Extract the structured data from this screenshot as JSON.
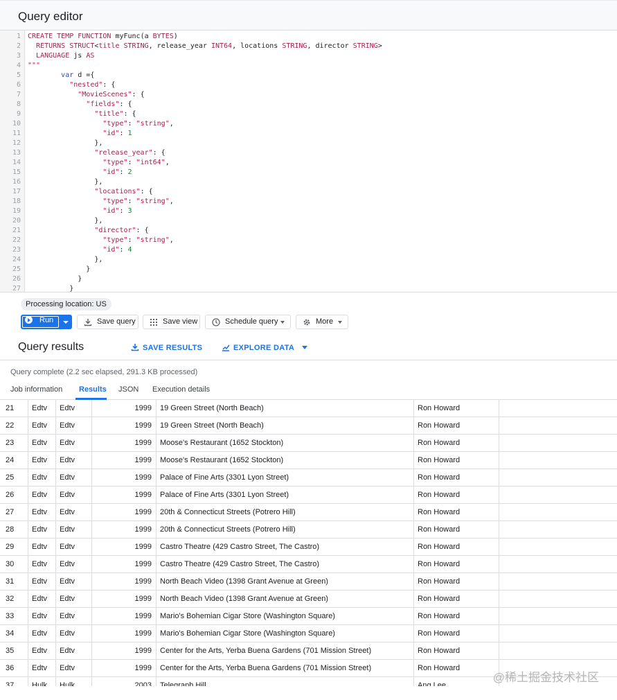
{
  "editor": {
    "title": "Query editor",
    "lines": [
      {
        "n": "1",
        "html": "<span class=\"kw\">CREATE TEMP FUNCTION</span> myFunc(a <span class=\"kw\">BYTES</span>)"
      },
      {
        "n": "2",
        "html": "  <span class=\"kw\">RETURNS STRUCT</span>&lt;<span class=\"kw\">title</span> <span class=\"kw\">STRING</span>, release_year <span class=\"kw\">INT64</span>, locations <span class=\"kw\">STRING</span>, director <span class=\"kw\">STRING</span>&gt;"
      },
      {
        "n": "3",
        "html": "  <span class=\"kw\">LANGUAGE</span> js <span class=\"kw\">AS</span>"
      },
      {
        "n": "4",
        "html": "<span class=\"str\">\"\"\"</span>"
      },
      {
        "n": "5",
        "html": "        <span class=\"id\">var</span> d ={"
      },
      {
        "n": "6",
        "html": "          <span class=\"key\">\"nested\"</span>: {"
      },
      {
        "n": "7",
        "html": "            <span class=\"key\">\"MovieScenes\"</span>: {"
      },
      {
        "n": "8",
        "html": "              <span class=\"key\">\"fields\"</span>: {"
      },
      {
        "n": "9",
        "html": "                <span class=\"key\">\"title\"</span>: {"
      },
      {
        "n": "10",
        "html": "                  <span class=\"key\">\"type\"</span>: <span class=\"str\">\"string\"</span>,"
      },
      {
        "n": "11",
        "html": "                  <span class=\"key\">\"id\"</span>: <span class=\"num\">1</span>"
      },
      {
        "n": "12",
        "html": "                },"
      },
      {
        "n": "13",
        "html": "                <span class=\"key\">\"release_year\"</span>: {"
      },
      {
        "n": "14",
        "html": "                  <span class=\"key\">\"type\"</span>: <span class=\"str\">\"int64\"</span>,"
      },
      {
        "n": "15",
        "html": "                  <span class=\"key\">\"id\"</span>: <span class=\"num\">2</span>"
      },
      {
        "n": "16",
        "html": "                },"
      },
      {
        "n": "17",
        "html": "                <span class=\"key\">\"locations\"</span>: {"
      },
      {
        "n": "18",
        "html": "                  <span class=\"key\">\"type\"</span>: <span class=\"str\">\"string\"</span>,"
      },
      {
        "n": "19",
        "html": "                  <span class=\"key\">\"id\"</span>: <span class=\"num\">3</span>"
      },
      {
        "n": "20",
        "html": "                },"
      },
      {
        "n": "21",
        "html": "                <span class=\"key\">\"director\"</span>: {"
      },
      {
        "n": "22",
        "html": "                  <span class=\"key\">\"type\"</span>: <span class=\"str\">\"string\"</span>,"
      },
      {
        "n": "23",
        "html": "                  <span class=\"key\">\"id\"</span>: <span class=\"num\">4</span>"
      },
      {
        "n": "24",
        "html": "                },"
      },
      {
        "n": "25",
        "html": "              }"
      },
      {
        "n": "26",
        "html": "            }"
      },
      {
        "n": "27",
        "html": "          }"
      }
    ]
  },
  "processing_location": "Processing location: US",
  "toolbar": {
    "run_label": "Run",
    "save_query_label": "Save query",
    "save_view_label": "Save view",
    "schedule_query_label": "Schedule query",
    "more_label": "More"
  },
  "results": {
    "title": "Query results",
    "save_results_label": "SAVE RESULTS",
    "explore_data_label": "EXPLORE DATA",
    "status": "Query complete (2.2 sec elapsed, 291.3 KB processed)",
    "tabs": [
      "Job information",
      "Results",
      "JSON",
      "Execution details"
    ],
    "active_tab": "Results",
    "rows": [
      {
        "n": "21",
        "a": "Edtv",
        "b": "Edtv",
        "year": "1999",
        "loc": "19 Green Street (North Beach)",
        "dir": "Ron Howard"
      },
      {
        "n": "22",
        "a": "Edtv",
        "b": "Edtv",
        "year": "1999",
        "loc": "19 Green Street (North Beach)",
        "dir": "Ron Howard"
      },
      {
        "n": "23",
        "a": "Edtv",
        "b": "Edtv",
        "year": "1999",
        "loc": "Moose's Restaurant (1652 Stockton)",
        "dir": "Ron Howard"
      },
      {
        "n": "24",
        "a": "Edtv",
        "b": "Edtv",
        "year": "1999",
        "loc": "Moose's Restaurant (1652 Stockton)",
        "dir": "Ron Howard"
      },
      {
        "n": "25",
        "a": "Edtv",
        "b": "Edtv",
        "year": "1999",
        "loc": "Palace of Fine Arts (3301 Lyon Street)",
        "dir": "Ron Howard"
      },
      {
        "n": "26",
        "a": "Edtv",
        "b": "Edtv",
        "year": "1999",
        "loc": "Palace of Fine Arts (3301 Lyon Street)",
        "dir": "Ron Howard"
      },
      {
        "n": "27",
        "a": "Edtv",
        "b": "Edtv",
        "year": "1999",
        "loc": "20th & Connecticut Streets (Potrero Hill)",
        "dir": "Ron Howard"
      },
      {
        "n": "28",
        "a": "Edtv",
        "b": "Edtv",
        "year": "1999",
        "loc": "20th & Connecticut Streets (Potrero Hill)",
        "dir": "Ron Howard"
      },
      {
        "n": "29",
        "a": "Edtv",
        "b": "Edtv",
        "year": "1999",
        "loc": "Castro Theatre (429 Castro Street, The Castro)",
        "dir": "Ron Howard"
      },
      {
        "n": "30",
        "a": "Edtv",
        "b": "Edtv",
        "year": "1999",
        "loc": "Castro Theatre (429 Castro Street, The Castro)",
        "dir": "Ron Howard"
      },
      {
        "n": "31",
        "a": "Edtv",
        "b": "Edtv",
        "year": "1999",
        "loc": "North Beach Video (1398 Grant Avenue at Green)",
        "dir": "Ron Howard"
      },
      {
        "n": "32",
        "a": "Edtv",
        "b": "Edtv",
        "year": "1999",
        "loc": "North Beach Video (1398 Grant Avenue at Green)",
        "dir": "Ron Howard"
      },
      {
        "n": "33",
        "a": "Edtv",
        "b": "Edtv",
        "year": "1999",
        "loc": "Mario's Bohemian Cigar Store (Washington Square)",
        "dir": "Ron Howard"
      },
      {
        "n": "34",
        "a": "Edtv",
        "b": "Edtv",
        "year": "1999",
        "loc": "Mario's Bohemian Cigar Store (Washington Square)",
        "dir": "Ron Howard"
      },
      {
        "n": "35",
        "a": "Edtv",
        "b": "Edtv",
        "year": "1999",
        "loc": "Center for the Arts, Yerba Buena Gardens (701 Mission Street)",
        "dir": "Ron Howard"
      },
      {
        "n": "36",
        "a": "Edtv",
        "b": "Edtv",
        "year": "1999",
        "loc": "Center for the Arts, Yerba Buena Gardens (701 Mission Street)",
        "dir": "Ron Howard"
      },
      {
        "n": "37",
        "a": "Hulk",
        "b": "Hulk",
        "year": "2003",
        "loc": "Telegraph Hill",
        "dir": "Ang Lee"
      }
    ]
  },
  "watermark": "@稀土掘金技术社区",
  "colors": {
    "accent": "#1a73e8",
    "keyword": "#a31f4e",
    "number": "#1e7c3b"
  }
}
